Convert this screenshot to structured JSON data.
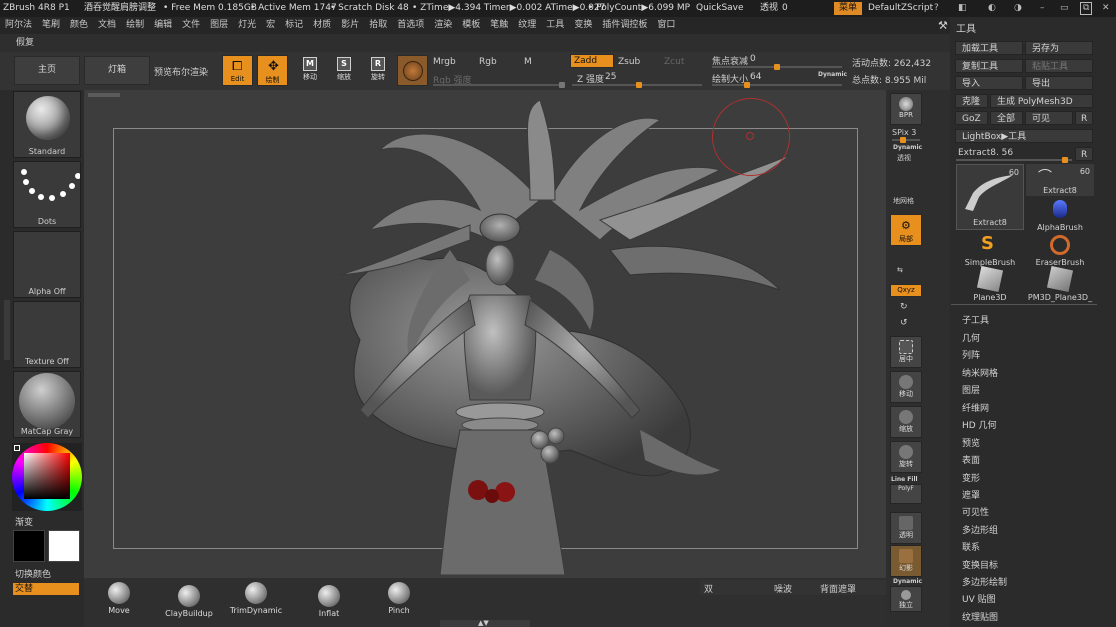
{
  "titlebar": {
    "app": "ZBrush 4R8 P1",
    "doc": "酒吞觉醒肩膀调整",
    "free_mem": "• Free Mem 0.185GB",
    "active_mem": "• Active Mem 1747",
    "scratch": "• Scratch Disk 48",
    "ztime": "• ZTime▶4.394 Timer▶0.002 ATime▶0.027",
    "polycount": "• PolyCount▶6.099 MP",
    "quicksave": "QuickSave",
    "transparency": "透视",
    "transparency_value": "0",
    "menu": "菜单",
    "zscript": "DefaultZScript"
  },
  "menubar": [
    "阿尔法",
    "笔刷",
    "颜色",
    "文档",
    "绘制",
    "编辑",
    "文件",
    "图层",
    "灯光",
    "宏",
    "标记",
    "材质",
    "影片",
    "拾取",
    "首选项",
    "渲染",
    "模板",
    "笔触",
    "纹理",
    "工具",
    "变换",
    "插件调控板",
    "窗口"
  ],
  "subbar": {
    "label": "假复"
  },
  "toolbar": {
    "home": "主页",
    "lightbox": "灯箱",
    "preview_render": "预览布尔渲染",
    "edit": "Edit",
    "draw": "绘制",
    "move": "移动",
    "scale": "缩放",
    "rotate": "旋转",
    "mrgb": "Mrgb",
    "rgb": "Rgb",
    "m": "M",
    "rgb_intensity": "Rgb 强度",
    "zadd": "Zadd",
    "zsub": "Zsub",
    "zcut": "Zcut",
    "z_intensity_label": "Z 强度",
    "z_intensity_value": "25",
    "focal_label": "焦点衰减",
    "focal_value": "0",
    "draw_size_label": "绘制大小",
    "draw_size_value": "64",
    "dynamic": "Dynamic",
    "active_points": "活动点数: 262,432",
    "total_points": "总点数: 8.955 Mil"
  },
  "leftpanel": {
    "brush": "Standard",
    "stroke": "Dots",
    "alpha": "Alpha Off",
    "texture": "Texture Off",
    "material": "MatCap Gray",
    "gradient": "渐变",
    "switch_color": "切换颜色",
    "alternate": "交替"
  },
  "rightstrip": {
    "bpr": "BPR",
    "spix": "SPix 3",
    "dynamic": "Dynamic",
    "persp": "透视",
    "floor": "地网格",
    "local": "局部",
    "xyz": "Qxyz",
    "frame": "居中",
    "move": "移动",
    "scale": "缩放",
    "rotate": "旋转",
    "linefill": "Line Fill",
    "polyf": "PolyF",
    "transp": "透明",
    "ghost": "幻影",
    "dynamic2": "Dynamic",
    "solo": "独立"
  },
  "toolpanel": {
    "title": "工具",
    "load": "加载工具",
    "saveas": "另存为",
    "copy": "复制工具",
    "paste": "粘贴工具",
    "import": "导入",
    "export": "导出",
    "clone": "克隆",
    "make_polymesh": "生成 PolyMesh3D",
    "goz": "GoZ",
    "all": "全部",
    "visible": "可见",
    "r": "R",
    "lightbox_tool": "LightBox▶工具",
    "extract_label": "Extract8. 56",
    "tools": [
      {
        "name": "Extract8",
        "count": "60"
      },
      {
        "name": "Extract8",
        "count": "60"
      },
      {
        "name": "AlphaBrush"
      },
      {
        "name": "SimpleBrush"
      },
      {
        "name": "EraserBrush"
      },
      {
        "name": "Plane3D"
      },
      {
        "name": "PM3D_Plane3D_"
      }
    ],
    "sections": [
      "子工具",
      "几何",
      "列阵",
      "纳米网格",
      "图层",
      "纤维网",
      "HD 几何",
      "预览",
      "表面",
      "变形",
      "遮罩",
      "可见性",
      "多边形组",
      "联系",
      "变换目标",
      "多边形绘制",
      "UV 贴图",
      "纹理贴图"
    ]
  },
  "bottombar": {
    "brushes": [
      "Move",
      "ClayBuildup",
      "TrimDynamic",
      "Inflat",
      "Pinch"
    ],
    "double": "双",
    "lazy": "噪波",
    "backface": "背面遮罩"
  },
  "colors": {
    "accent": "#e8901e",
    "panel": "#2b2b2b",
    "viewport": "#3d3d3d"
  }
}
